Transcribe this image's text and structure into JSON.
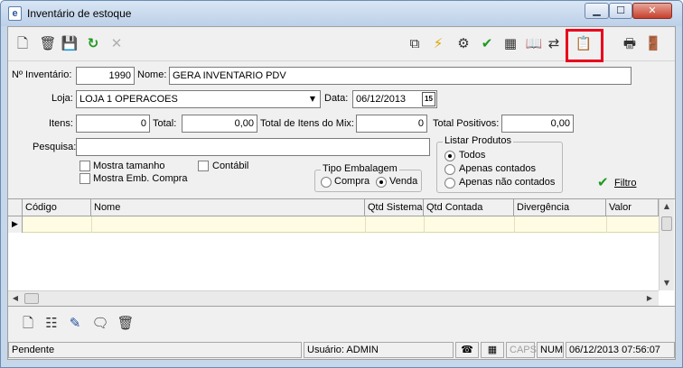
{
  "window": {
    "title": "Inventário de estoque",
    "app_icon_glyph": "e",
    "minimize_glyph": "▁",
    "maximize_glyph": "☐",
    "close_glyph": "✕"
  },
  "toolbar": {
    "icons": {
      "new": "new-document-icon",
      "delete": "trash-icon",
      "save": "save-icon",
      "refresh": "refresh-icon",
      "cancel": "cancel-icon",
      "copy": "copy-icon",
      "execute": "lightning-icon",
      "tools": "tools-icon",
      "confirm": "checkmark-icon",
      "spreadsheet": "spreadsheet-icon",
      "book_transfer": "book-transfer-icon",
      "paste": "clipboard-paste-icon",
      "print": "printer-icon",
      "exit": "exit-door-icon"
    },
    "highlight_color": "#e8001c"
  },
  "form": {
    "inventario_label": "Nº Inventário:",
    "inventario_value": "1990",
    "nome_label": "Nome:",
    "nome_value": "GERA INVENTARIO PDV",
    "loja_label": "Loja:",
    "loja_value": "LOJA 1 OPERACOES",
    "data_label": "Data:",
    "data_value": "06/12/2013",
    "calendar_glyph": "15",
    "itens_label": "Itens:",
    "itens_value": "0",
    "total_label": "Total:",
    "total_value": "0,00",
    "total_itens_mix_label": "Total de Itens do Mix:",
    "total_itens_mix_value": "0",
    "total_positivos_label": "Total Positivos:",
    "total_positivos_value": "0,00",
    "pesquisa_label": "Pesquisa:",
    "pesquisa_value": "",
    "mostra_tamanho_label": "Mostra tamanho",
    "contabil_label": "Contábil",
    "mostra_emb_compra_label": "Mostra Emb. Compra",
    "tipo_embalagem": {
      "title": "Tipo Embalagem",
      "options": [
        "Compra",
        "Venda"
      ],
      "selected": "Venda"
    },
    "listar_produtos": {
      "title": "Listar Produtos",
      "options": [
        "Todos",
        "Apenas contados",
        "Apenas não contados"
      ],
      "selected": "Todos"
    },
    "filtro_label": "Filtro"
  },
  "grid": {
    "columns": [
      "Código",
      "Nome",
      "Qtd Sistema",
      "Qtd Contada",
      "Divergência",
      "Valor"
    ],
    "row_indicator": "▶",
    "scroll_up": "▲",
    "scroll_down": "▼",
    "scroll_left": "◀",
    "scroll_right": "▶"
  },
  "bottom_toolbar": {
    "icons": [
      "new-item-icon",
      "edit-list-icon",
      "pencil-folder-icon",
      "comment-icon",
      "trash-icon"
    ]
  },
  "statusbar": {
    "status": "Pendente",
    "user": "Usuário: ADMIN",
    "caps": "CAPS",
    "num": "NUM",
    "datetime": "06/12/2013 07:56:07",
    "phone_glyph": "☎",
    "calc_glyph": "▦"
  }
}
